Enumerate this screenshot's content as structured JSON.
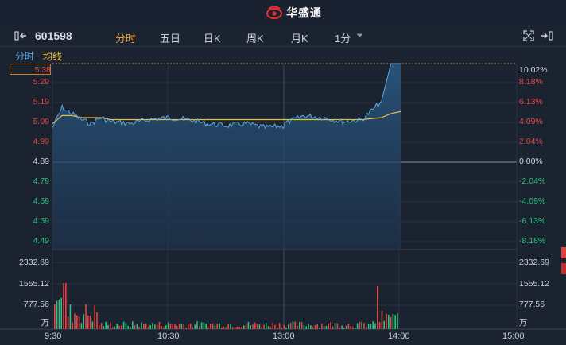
{
  "app": {
    "brand": "华盛通"
  },
  "toolbar": {
    "code": "601598",
    "tabs": [
      "分时",
      "五日",
      "日K",
      "周K",
      "月K",
      "1分"
    ],
    "active_tab": "分时"
  },
  "legend": {
    "intraday": "分时",
    "avg": "均线"
  },
  "price_axis": {
    "left": [
      "5.38",
      "5.29",
      "5.19",
      "5.09",
      "4.99",
      "4.89",
      "4.79",
      "4.69",
      "4.59",
      "4.49"
    ],
    "right": [
      "10.02%",
      "8.18%",
      "6.13%",
      "4.09%",
      "2.04%",
      "0.00%",
      "-2.04%",
      "-4.09%",
      "-6.13%",
      "-8.18%"
    ]
  },
  "volume_axis": {
    "left": [
      "2332.69",
      "1555.12",
      "777.56",
      "万"
    ],
    "right": [
      "2332.69",
      "1555.12",
      "777.56",
      "万"
    ]
  },
  "time_axis": [
    "9:30",
    "10:30",
    "13:00",
    "14:00",
    "15:00"
  ],
  "colors": {
    "up": "#e64545",
    "down": "#2ec27e",
    "price_line": "#5aa8e8",
    "avg_line": "#e8c040",
    "accent": "#f0a030"
  },
  "chart_data": {
    "type": "line",
    "x": [
      "9:30",
      "9:35",
      "9:40",
      "9:45",
      "9:50",
      "9:55",
      "10:00",
      "10:10",
      "10:20",
      "10:30",
      "10:40",
      "10:50",
      "11:00",
      "11:10",
      "11:20",
      "11:30",
      "13:00",
      "13:10",
      "13:20",
      "13:30",
      "13:40",
      "13:50",
      "13:55",
      "14:00"
    ],
    "series": [
      {
        "values": [
          5.06,
          5.16,
          5.13,
          5.1,
          5.08,
          5.11,
          5.09,
          5.08,
          5.1,
          5.11,
          5.1,
          5.08,
          5.07,
          5.08,
          5.06,
          5.07,
          5.08,
          5.12,
          5.11,
          5.09,
          5.1,
          5.19,
          5.38,
          5.38
        ]
      },
      {
        "values": [
          5.08,
          5.12,
          5.12,
          5.11,
          5.11,
          5.11,
          5.1,
          5.1,
          5.1,
          5.1,
          5.1,
          5.1,
          5.1,
          5.1,
          5.1,
          5.1,
          5.1,
          5.1,
          5.1,
          5.1,
          5.1,
          5.11,
          5.13,
          5.14
        ]
      }
    ],
    "ylim": [
      4.4,
      5.38
    ]
  }
}
